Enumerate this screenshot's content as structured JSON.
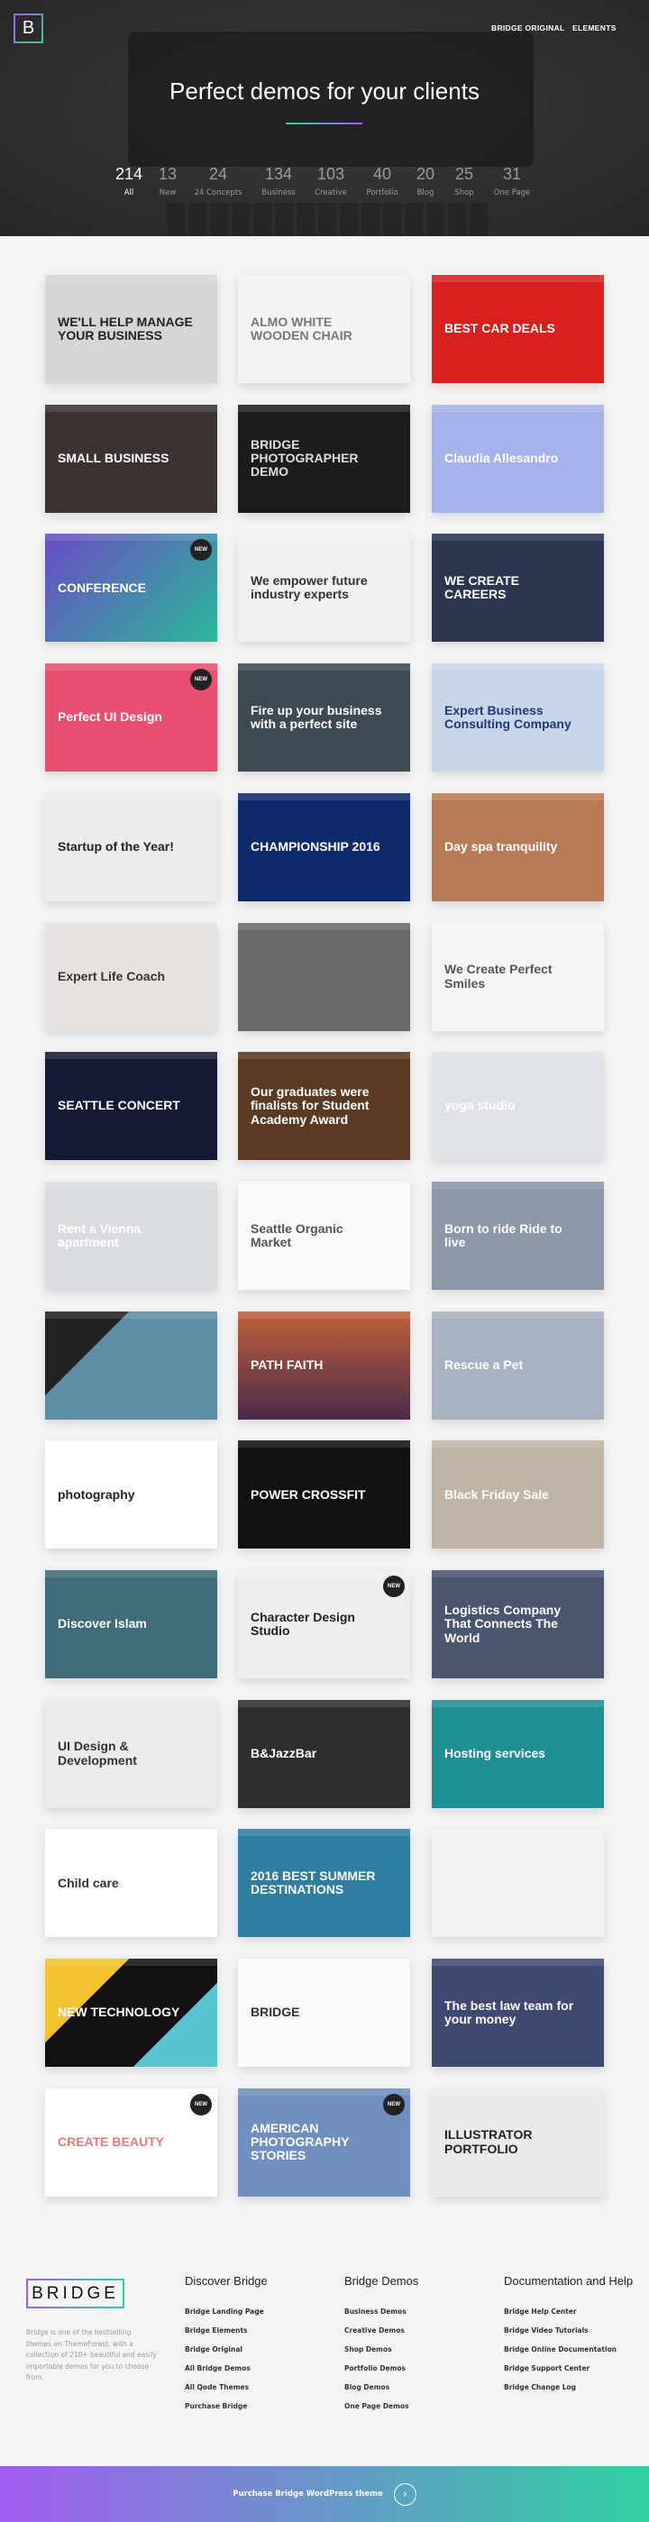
{
  "header": {
    "logo": "B",
    "nav": [
      "BRIDGE ORIGINAL",
      "ELEMENTS"
    ],
    "title": "Perfect demos for your clients",
    "filters": [
      {
        "count": "214",
        "label": "All"
      },
      {
        "count": "13",
        "label": "New"
      },
      {
        "count": "24",
        "label": "24 Concepts"
      },
      {
        "count": "134",
        "label": "Business"
      },
      {
        "count": "103",
        "label": "Creative"
      },
      {
        "count": "40",
        "label": "Portfolio"
      },
      {
        "count": "20",
        "label": "Blog"
      },
      {
        "count": "25",
        "label": "Shop"
      },
      {
        "count": "31",
        "label": "One Page"
      }
    ],
    "active_filter": "All"
  },
  "new_badge": "NEW",
  "demos": [
    {
      "title": "WE'LL HELP MANAGE YOUR BUSINESS",
      "bg": "#d6d6d6",
      "fg": "#222"
    },
    {
      "title": "ALMO WHITE WOODEN CHAIR",
      "bg": "#f3f3f3",
      "fg": "#777"
    },
    {
      "title": "BEST CAR DEALS",
      "bg": "#d8201e",
      "fg": "#fff"
    },
    {
      "title": "SMALL BUSINESS",
      "bg": "#3a3330",
      "fg": "#fff"
    },
    {
      "title": "BRIDGE PHOTOGRAPHER DEMO",
      "bg": "#1c1c1c",
      "fg": "#ddd"
    },
    {
      "title": "Claudia Allesandro",
      "bg": "#a6b3ea",
      "fg": "#fff"
    },
    {
      "title": "CONFERENCE",
      "bg": "linear-gradient(135deg,#6a4bc4,#2bb89a)",
      "fg": "#fff",
      "new": true
    },
    {
      "title": "We empower future industry experts",
      "bg": "#f1f1f1",
      "fg": "#333"
    },
    {
      "title": "WE CREATE CAREERS",
      "bg": "#2a3550",
      "fg": "#fff"
    },
    {
      "title": "Perfect UI Design",
      "bg": "#e9506f",
      "fg": "#fff",
      "new": true
    },
    {
      "title": "Fire up your business with a perfect site",
      "bg": "#3d4a52",
      "fg": "#fff"
    },
    {
      "title": "Expert Business Consulting Company",
      "bg": "#c8d6ea",
      "fg": "#1c3a78"
    },
    {
      "title": "Startup of the Year!",
      "bg": "#ececec",
      "fg": "#222"
    },
    {
      "title": "CHAMPIONSHIP 2016",
      "bg": "#0f2a6a",
      "fg": "#fff"
    },
    {
      "title": "Day spa tranquility",
      "bg": "#b87a55",
      "fg": "#fff"
    },
    {
      "title": "Expert Life Coach",
      "bg": "#e6e2df",
      "fg": "#333"
    },
    {
      "title": "",
      "bg": "#6a6a6a",
      "fg": "#fff"
    },
    {
      "title": "We Create Perfect Smiles",
      "bg": "#f5f5f5",
      "fg": "#555"
    },
    {
      "title": "SEATTLE CONCERT",
      "bg": "#141a35",
      "fg": "#fff"
    },
    {
      "title": "Our graduates were finalists for Student Academy Award",
      "bg": "#5a3a22",
      "fg": "#fff"
    },
    {
      "title": "yoga studio",
      "bg": "#dfe3e8",
      "fg": "#fff"
    },
    {
      "title": "Rent a Vienna apartment",
      "bg": "#d9dde0",
      "fg": "#fff"
    },
    {
      "title": "Seattle Organic Market",
      "bg": "#fafafa",
      "fg": "#555"
    },
    {
      "title": "Born to ride Ride to live",
      "bg": "#8b98a8",
      "fg": "#fff"
    },
    {
      "title": "",
      "bg": "linear-gradient(135deg,#222 30%,#5e8ea3 30%)",
      "fg": "#fff"
    },
    {
      "title": "PATH FAITH",
      "bg": "linear-gradient(180deg,#c0603a,#4a2a4a)",
      "fg": "#fff"
    },
    {
      "title": "Rescue a Pet",
      "bg": "#a9b2c0",
      "fg": "#fff"
    },
    {
      "title": "photography",
      "bg": "#ffffff",
      "fg": "#222"
    },
    {
      "title": "POWER CROSSFIT",
      "bg": "#111",
      "fg": "#fff"
    },
    {
      "title": "Black Friday Sale",
      "bg": "#c2b4a4",
      "fg": "#fff"
    },
    {
      "title": "Discover Islam",
      "bg": "#3f6c78",
      "fg": "#fff"
    },
    {
      "title": "Character Design Studio",
      "bg": "#eeeeee",
      "fg": "#222",
      "new": true
    },
    {
      "title": "Logistics Company That Connects The World",
      "bg": "#4a5570",
      "fg": "#fff"
    },
    {
      "title": "UI Design & Development",
      "bg": "#ebebeb",
      "fg": "#333"
    },
    {
      "title": "B&JazzBar",
      "bg": "#2e2e2e",
      "fg": "#fff"
    },
    {
      "title": "Hosting services",
      "bg": "#1f8f94",
      "fg": "#fff"
    },
    {
      "title": "Child care",
      "bg": "#ffffff",
      "fg": "#333"
    },
    {
      "title": "2016 BEST SUMMER DESTINATIONS",
      "bg": "#2f7ea0",
      "fg": "#fff"
    },
    {
      "title": "",
      "bg": "#f2f2f2",
      "fg": "#333"
    },
    {
      "title": "NEW TECHNOLOGY",
      "bg": "linear-gradient(135deg,#f2c230 30%,#111 30% 70%,#5ac3d0 70%)",
      "fg": "#fff"
    },
    {
      "title": "BRIDGE",
      "bg": "#fafafa",
      "fg": "#333"
    },
    {
      "title": "The best law team for your money",
      "bg": "#3f4a72",
      "fg": "#fff"
    },
    {
      "title": "CREATE BEAUTY",
      "bg": "#ffffff",
      "fg": "#e57b7b",
      "new": true
    },
    {
      "title": "AMERICAN PHOTOGRAPHY STORIES",
      "bg": "#6f8fbf",
      "fg": "#fff",
      "new": true
    },
    {
      "title": "ILLUSTRATOR PORTFOLIO",
      "bg": "#eaeaea",
      "fg": "#222"
    }
  ],
  "footer": {
    "logo": "BRIDGE",
    "description": "Bridge is one of the bestselling themes on ThemeForest, with a collection of 210+ beautiful and easily importable demos for you to choose from.",
    "columns": [
      {
        "title": "Discover Bridge",
        "links": [
          "Bridge Landing Page",
          "Bridge Elements",
          "Bridge Original",
          "All Bridge Demos",
          "All Qode Themes",
          "Purchase Bridge"
        ]
      },
      {
        "title": "Bridge Demos",
        "links": [
          "Business Demos",
          "Creative Demos",
          "Shop Demos",
          "Portfolio Demos",
          "Blog Demos",
          "One Page Demos"
        ]
      },
      {
        "title": "Documentation and Help",
        "links": [
          "Bridge Help Center",
          "Bridge Video Tutorials",
          "Bridge Online Documentation",
          "Bridge Support Center",
          "Bridge Change Log"
        ]
      }
    ]
  },
  "purchase": {
    "label": "Purchase Bridge WordPress theme",
    "icon": "chevron-right-icon"
  },
  "colors": {
    "accent_start": "#a15cf0",
    "accent_end": "#2fd1a0"
  }
}
